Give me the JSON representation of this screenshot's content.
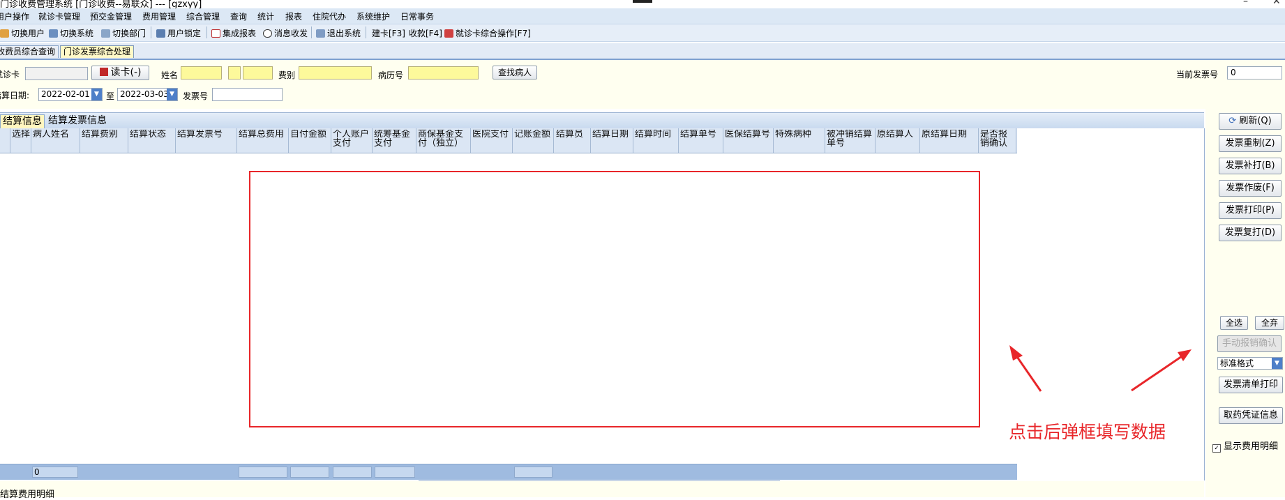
{
  "window": {
    "title": "门诊收费管理系统 [门诊收费--易联众] --- [gzxyy]",
    "minimize": "–",
    "close": "✕"
  },
  "menu": [
    "用户操作",
    "就诊卡管理",
    "预交金管理",
    "费用管理",
    "综合管理",
    "查询",
    "统计",
    "报表",
    "住院代办",
    "系统维护",
    "日常事务"
  ],
  "toolbar": [
    {
      "label": "切换用户",
      "icon": "switch-user-icon"
    },
    {
      "label": "切换系统",
      "icon": "switch-system-icon"
    },
    {
      "label": "切换部门",
      "icon": "switch-department-icon"
    },
    {
      "label": "用户锁定",
      "icon": "user-lock-icon"
    },
    {
      "label": "集成报表",
      "icon": "integrated-report-icon"
    },
    {
      "label": "消息收发",
      "icon": "message-info-icon"
    },
    {
      "label": "退出系统",
      "icon": "exit-system-icon"
    },
    {
      "label": "建卡[F3]",
      "icon": ""
    },
    {
      "label": "收款[F4]",
      "icon": ""
    },
    {
      "label": "就诊卡综合操作[F7]",
      "icon": "card-operation-icon"
    }
  ],
  "doc_tabs": [
    "收费员综合查询",
    "门诊发票综合处理"
  ],
  "form": {
    "card_label": "就诊卡",
    "card_value": "",
    "read_card_button": "读卡(-)",
    "name_label": "姓名",
    "fee_type_label": "费别",
    "record_label": "病历号",
    "find_patient_button": "查找病人",
    "current_invoice_label": "当前发票号",
    "current_invoice_value": "0",
    "settle_date_label": "结算日期:",
    "date_from": "2022-02-01",
    "to_label": "至",
    "date_to": "2022-03-03",
    "invoice_no_label": "发票号"
  },
  "grid_tabs": [
    "结算信息",
    "结算发票信息"
  ],
  "grid": {
    "columns": [
      "选择",
      "病人姓名",
      "结算费别",
      "结算状态",
      "结算发票号",
      "结算总费用",
      "自付金额",
      "个人账户支付",
      "统筹基金支付",
      "商保基金支付（独立）",
      "医院支付",
      "记账金额",
      "结算员",
      "结算日期",
      "结算时间",
      "结算单号",
      "医保结算号",
      "特殊病种",
      "被冲销结算单号",
      "原结算人",
      "原结算日期",
      "是否报销确认"
    ],
    "footer_count": "0"
  },
  "right_panel": {
    "refresh": "刷新(Q)",
    "reprint_reset": "发票重制(Z)",
    "supplement_print": "发票补打(B)",
    "void": "发票作废(F)",
    "print": "发票打印(P)",
    "reprint": "发票复打(D)",
    "select_all": "全选",
    "deselect_all": "全弃",
    "manual_confirm": "手动报销确认",
    "format_value": "标准格式",
    "list_print": "发票清单打印",
    "medicine_voucher": "取药凭证信息",
    "show_details": "显示费用明细",
    "show_details_checked": true
  },
  "bottom_label": "结算费用明细",
  "annotation": "点击后弹框填写数据",
  "colors": {
    "annotation_red": "#e8262a",
    "yellow_field": "#fdf99b",
    "panel_bg": "#fffff0",
    "header_blue": "#dbe6f4"
  }
}
